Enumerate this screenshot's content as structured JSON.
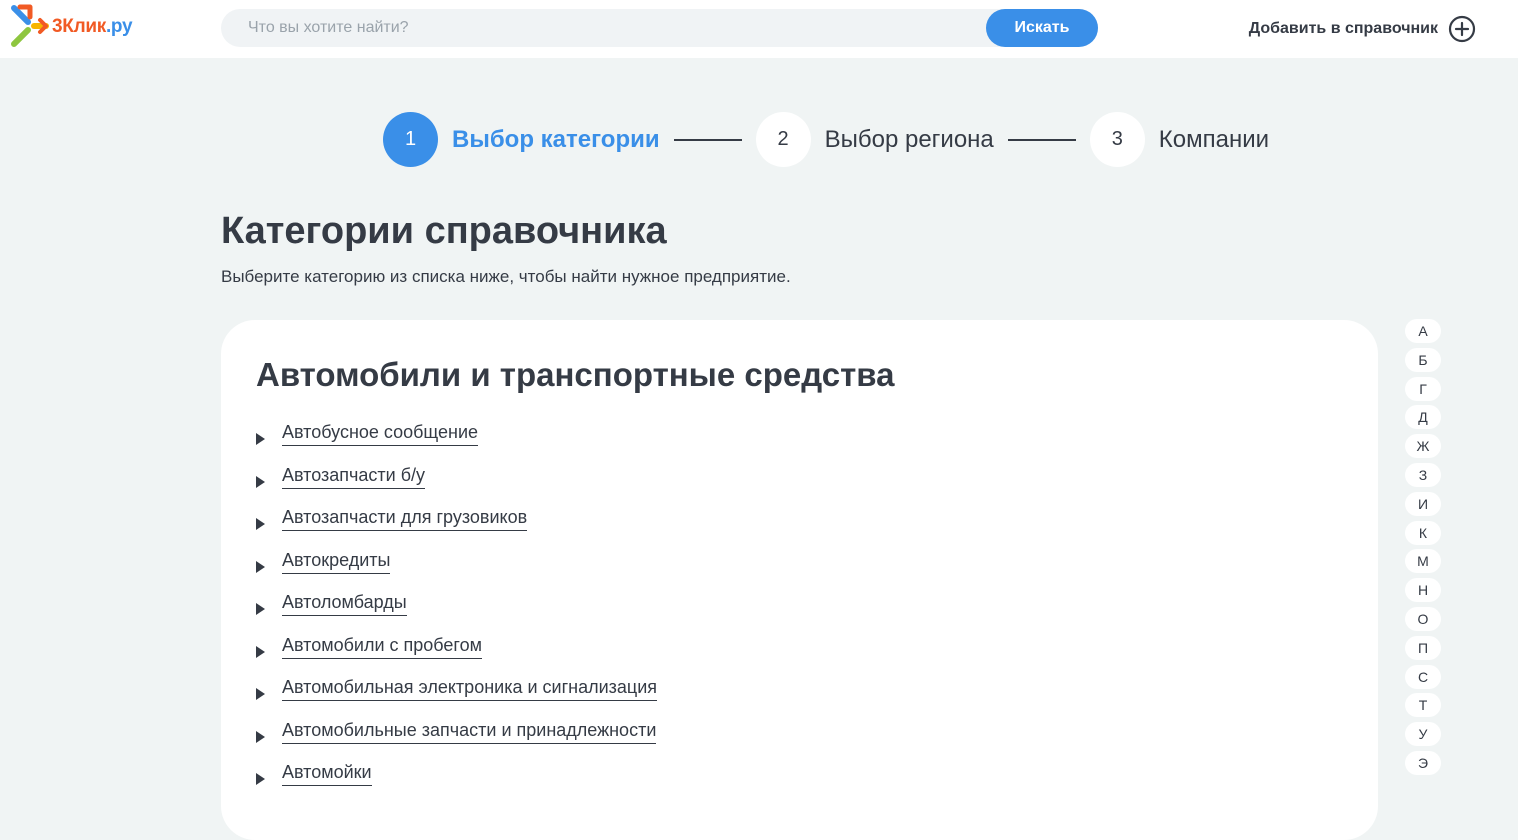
{
  "header": {
    "logo_part1": "3Клик",
    "logo_part2": ".ру",
    "search_placeholder": "Что вы хотите найти?",
    "search_button": "Искать",
    "add_link": "Добавить в справочник"
  },
  "stepper": {
    "steps": [
      {
        "number": "1",
        "label": "Выбор категории",
        "active": true
      },
      {
        "number": "2",
        "label": "Выбор региона",
        "active": false
      },
      {
        "number": "3",
        "label": "Компании",
        "active": false
      }
    ]
  },
  "page": {
    "title": "Категории справочника",
    "subtitle": "Выберите категорию из списка ниже, чтобы найти нужное предприятие."
  },
  "card": {
    "title": "Автомобили и транспортные средства",
    "items": [
      "Автобусное сообщение",
      "Автозапчасти б/у",
      "Автозапчасти для грузовиков",
      "Автокредиты",
      "Автоломбарды",
      "Автомобили с пробегом",
      "Автомобильная электроника и сигнализация",
      "Автомобильные запчасти и принадлежности",
      "Автомойки"
    ]
  },
  "alphabet": [
    "А",
    "Б",
    "Г",
    "Д",
    "Ж",
    "З",
    "И",
    "К",
    "М",
    "Н",
    "О",
    "П",
    "С",
    "Т",
    "У",
    "Э"
  ],
  "colors": {
    "accent": "#3a8fe8",
    "logo_orange": "#f15a24",
    "text": "#353b45",
    "background": "#f0f4f4"
  },
  "icons": {
    "logo": "arrows-logo-icon",
    "add": "plus-circle-icon",
    "bullet": "triangle-right-icon"
  }
}
